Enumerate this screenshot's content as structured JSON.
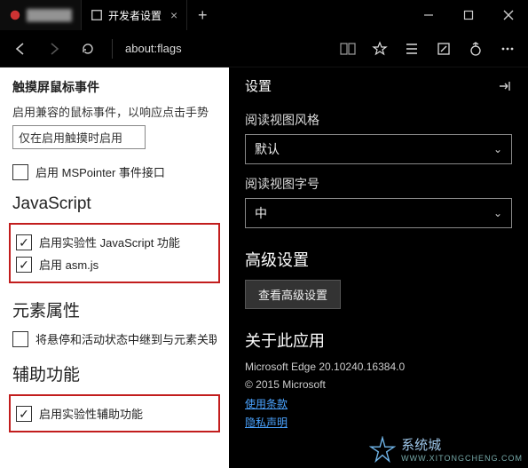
{
  "titlebar": {
    "tabs": [
      {
        "title": "██████",
        "active": false
      },
      {
        "title": "开发者设置",
        "active": true
      }
    ]
  },
  "toolbar": {
    "address": "about:flags"
  },
  "left": {
    "h_touch": "触摸屏鼠标事件",
    "touch_desc": "启用兼容的鼠标事件，以响应点击手势",
    "touch_select": "仅在启用触摸时启用",
    "chk_mspointer": "启用 MSPointer 事件接口",
    "h_js": "JavaScript",
    "chk_js_exp": "启用实验性 JavaScript 功能",
    "chk_asm": "启用 asm.js",
    "h_elem": "元素属性",
    "chk_suspend": "将悬停和活动状态中继到与元素关联",
    "h_a11y": "辅助功能",
    "chk_a11y_exp": "启用实验性辅助功能"
  },
  "right": {
    "panel_title": "设置",
    "lbl_style": "阅读视图风格",
    "sel_style": "默认",
    "lbl_size": "阅读视图字号",
    "sel_size": "中",
    "h_advanced": "高级设置",
    "btn_advanced": "查看高级设置",
    "h_about": "关于此应用",
    "version": "Microsoft Edge 20.10240.16384.0",
    "copyright": "© 2015 Microsoft",
    "link_terms": "使用条款",
    "link_privacy": "隐私声明"
  },
  "watermark": {
    "brand": "系统城",
    "url": "WWW.XITONGCHENG.COM"
  }
}
